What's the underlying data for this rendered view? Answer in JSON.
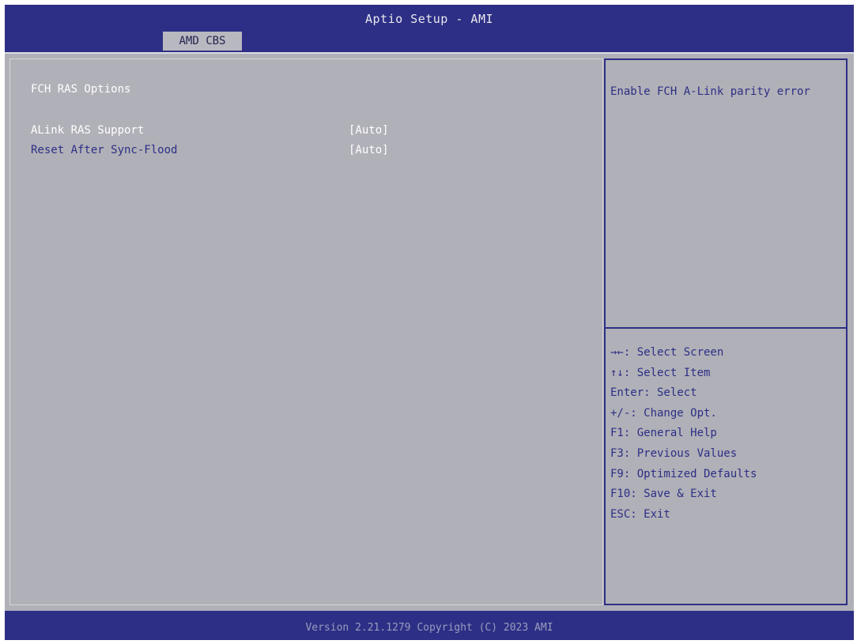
{
  "header": {
    "title": "Aptio Setup - AMI",
    "tab_label": "AMD CBS"
  },
  "main": {
    "section_title": "FCH RAS Options",
    "settings": [
      {
        "label": "ALink RAS Support",
        "value": "[Auto]"
      },
      {
        "label": "Reset After Sync-Flood",
        "value": "[Auto]"
      }
    ]
  },
  "help": {
    "description": "Enable FCH A-Link parity error",
    "keys": [
      "→←: Select Screen",
      "↑↓: Select Item",
      "Enter: Select",
      "+/-: Change Opt.",
      "F1: General Help",
      "F3: Previous Values",
      "F9: Optimized Defaults",
      "F10: Save & Exit",
      "ESC: Exit"
    ]
  },
  "footer": {
    "version_text": "Version 2.21.1279 Copyright (C) 2023 AMI"
  },
  "colors": {
    "frame_blue": "#2d2f86",
    "panel_grey": "#b0b0b8",
    "tab_grey": "#b8b8c0",
    "selected_text": "#ffffff"
  }
}
